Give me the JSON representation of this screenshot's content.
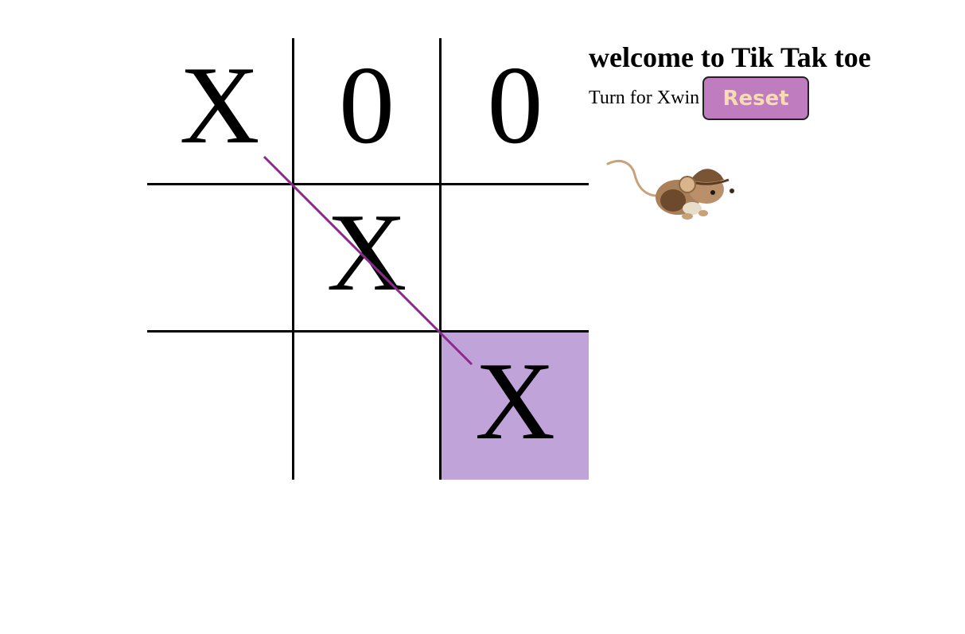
{
  "header": {
    "title": "welcome to Tik Tak toe",
    "turn_text": "Turn for Xwin",
    "reset_label": "Reset"
  },
  "board": {
    "cells": [
      "X",
      "0",
      "0",
      "",
      "X",
      "",
      "",
      "",
      "X"
    ],
    "winning_cells": [
      0,
      4,
      8
    ],
    "highlight_cell": 8
  },
  "colors": {
    "win_line": "#8b2a8b",
    "highlight": "#c0a3d9",
    "reset_bg": "#bf7cbf",
    "reset_text": "#f6dcb2"
  },
  "mascot": {
    "icon": "mouse-icon"
  }
}
